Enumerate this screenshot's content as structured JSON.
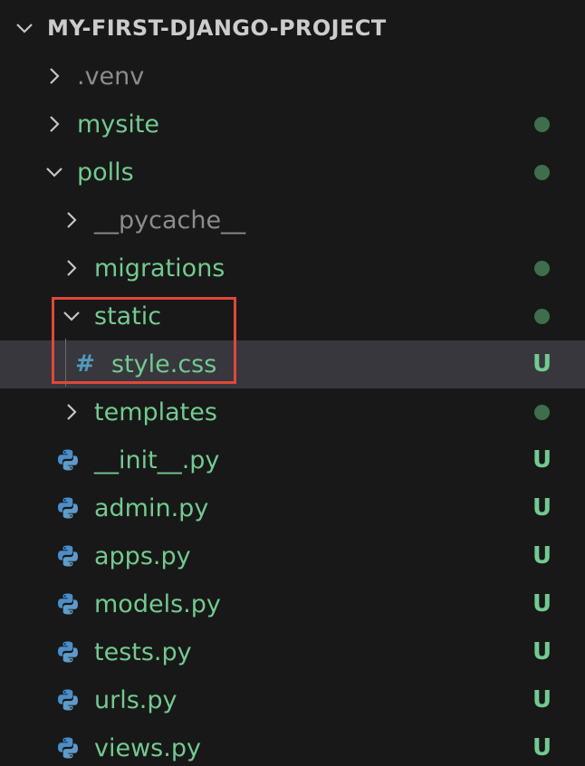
{
  "colors": {
    "background": "#181818",
    "selected_row": "#37373d",
    "untracked_green": "#73c991",
    "ignored_gray": "#8c8c8c",
    "dot_green": "#3f6e4c",
    "chevron": "#c5c5c5",
    "highlight_border": "#e0483a",
    "css_icon": "#519aba",
    "python_blue": "#4a8ec9",
    "python_yellow": "#5f9bc9"
  },
  "explorer": {
    "root": {
      "label": "MY-FIRST-DJANGO-PROJECT",
      "expanded": true
    },
    "items": [
      {
        "label": ".venv",
        "kind": "folder",
        "expanded": false,
        "status": "ignored",
        "badge": "",
        "icon": "chevron-right-icon"
      },
      {
        "label": "mysite",
        "kind": "folder",
        "expanded": false,
        "status": "dot",
        "badge": "",
        "icon": "chevron-right-icon"
      },
      {
        "label": "polls",
        "kind": "folder",
        "expanded": true,
        "status": "dot",
        "badge": "",
        "icon": "chevron-down-icon"
      },
      {
        "label": "__pycache__",
        "kind": "folder",
        "expanded": false,
        "status": "ignored",
        "badge": "",
        "icon": "chevron-right-icon"
      },
      {
        "label": "migrations",
        "kind": "folder",
        "expanded": false,
        "status": "dot",
        "badge": "",
        "icon": "chevron-right-icon"
      },
      {
        "label": "static",
        "kind": "folder",
        "expanded": true,
        "status": "dot",
        "badge": "",
        "icon": "chevron-down-icon"
      },
      {
        "label": "style.css",
        "kind": "file",
        "selected": true,
        "status": "untracked",
        "badge": "U",
        "icon": "css-hash-icon",
        "icon_glyph": "#"
      },
      {
        "label": "templates",
        "kind": "folder",
        "expanded": false,
        "status": "dot",
        "badge": "",
        "icon": "chevron-right-icon"
      },
      {
        "label": "__init__.py",
        "kind": "file",
        "status": "untracked",
        "badge": "U",
        "icon": "python-icon"
      },
      {
        "label": "admin.py",
        "kind": "file",
        "status": "untracked",
        "badge": "U",
        "icon": "python-icon"
      },
      {
        "label": "apps.py",
        "kind": "file",
        "status": "untracked",
        "badge": "U",
        "icon": "python-icon"
      },
      {
        "label": "models.py",
        "kind": "file",
        "status": "untracked",
        "badge": "U",
        "icon": "python-icon"
      },
      {
        "label": "tests.py",
        "kind": "file",
        "status": "untracked",
        "badge": "U",
        "icon": "python-icon"
      },
      {
        "label": "urls.py",
        "kind": "file",
        "status": "untracked",
        "badge": "U",
        "icon": "python-icon"
      },
      {
        "label": "views.py",
        "kind": "file",
        "status": "untracked",
        "badge": "U",
        "icon": "python-icon"
      }
    ]
  }
}
